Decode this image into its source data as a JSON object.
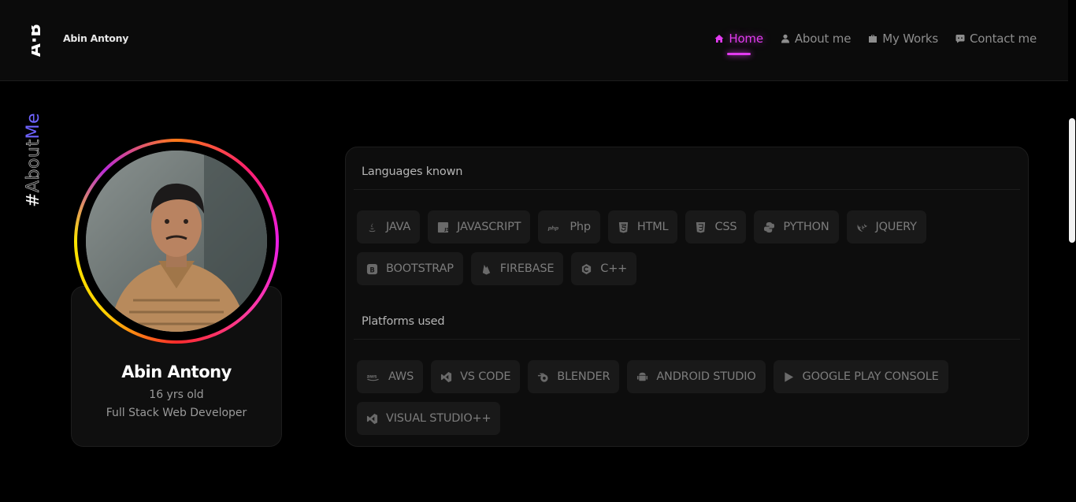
{
  "header": {
    "logo": "A·B",
    "brand_name": "Abin Antony",
    "nav": [
      {
        "label": "Home",
        "icon": "home-icon",
        "active": true
      },
      {
        "label": "About me",
        "icon": "user-icon",
        "active": false
      },
      {
        "label": "My Works",
        "icon": "briefcase-icon",
        "active": false
      },
      {
        "label": "Contact me",
        "icon": "chat-icon",
        "active": false
      }
    ]
  },
  "section_label": {
    "hash": "#",
    "about": "About",
    "me": "Me"
  },
  "profile": {
    "name": "Abin Antony",
    "age": "16 yrs old",
    "role": "Full Stack Web Developer"
  },
  "languages": {
    "title": "Languages known",
    "items": [
      {
        "label": "JAVA",
        "icon": "java-icon"
      },
      {
        "label": "JAVASCRIPT",
        "icon": "javascript-icon"
      },
      {
        "label": "Php",
        "icon": "php-icon"
      },
      {
        "label": "HTML",
        "icon": "html5-icon"
      },
      {
        "label": "CSS",
        "icon": "css3-icon"
      },
      {
        "label": "PYTHON",
        "icon": "python-icon"
      },
      {
        "label": "JQUERY",
        "icon": "jquery-icon"
      },
      {
        "label": "BOOTSTRAP",
        "icon": "bootstrap-icon"
      },
      {
        "label": "FIREBASE",
        "icon": "firebase-icon"
      },
      {
        "label": "C++",
        "icon": "cplusplus-icon"
      }
    ]
  },
  "platforms": {
    "title": "Platforms used",
    "items": [
      {
        "label": "AWS",
        "icon": "aws-icon"
      },
      {
        "label": "VS CODE",
        "icon": "vscode-icon"
      },
      {
        "label": "BLENDER",
        "icon": "blender-icon"
      },
      {
        "label": "ANDROID STUDIO",
        "icon": "android-icon"
      },
      {
        "label": "GOOGLE PLAY CONSOLE",
        "icon": "google-play-icon"
      },
      {
        "label": "VISUAL STUDIO++",
        "icon": "visual-studio-icon"
      }
    ]
  },
  "colors": {
    "accent": "#e23bf0",
    "background": "#000000",
    "card": "#0d0d0d",
    "chip": "#191919",
    "muted_text": "#7c7c7c"
  }
}
